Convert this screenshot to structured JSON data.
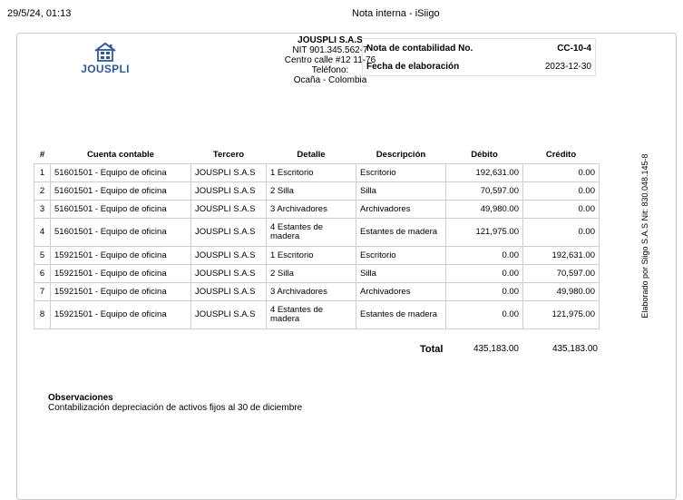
{
  "print_header": {
    "datetime": "29/5/24, 01:13",
    "title": "Nota interna - iSiigo"
  },
  "logo": {
    "icon": "house-icon",
    "text": "JOUSPLI",
    "color": "#2b5aa0"
  },
  "company": {
    "name": "JOUSPLI S.A.S",
    "nit": "NIT 901.345.562-7",
    "address": "Centro calle #12 11-76",
    "phone": "Teléfono:",
    "location": "Ocaña - Colombia"
  },
  "meta": {
    "note_label": "Nota de contabilidad No.",
    "note_value": "CC-10-4",
    "date_label": "Fecha de elaboración",
    "date_value": "2023-12-30"
  },
  "table": {
    "headers": [
      "#",
      "Cuenta contable",
      "Tercero",
      "Detalle",
      "Descripción",
      "Débito",
      "Crédito"
    ],
    "rows": [
      {
        "n": "1",
        "cuenta": "51601501 - Equipo de oficina",
        "tercero": "JOUSPLI S.A.S",
        "detalle": "1 Escritorio",
        "descripcion": "Escritorio",
        "debito": "192,631.00",
        "credito": "0.00"
      },
      {
        "n": "2",
        "cuenta": "51601501 - Equipo de oficina",
        "tercero": "JOUSPLI S.A.S",
        "detalle": "2 Silla",
        "descripcion": "Silla",
        "debito": "70,597.00",
        "credito": "0.00"
      },
      {
        "n": "3",
        "cuenta": "51601501 - Equipo de oficina",
        "tercero": "JOUSPLI S.A.S",
        "detalle": "3 Archivadores",
        "descripcion": "Archivadores",
        "debito": "49,980.00",
        "credito": "0.00"
      },
      {
        "n": "4",
        "cuenta": "51601501 - Equipo de oficina",
        "tercero": "JOUSPLI S.A.S",
        "detalle": "4 Estantes de madera",
        "descripcion": "Estantes de madera",
        "debito": "121,975.00",
        "credito": "0.00"
      },
      {
        "n": "5",
        "cuenta": "15921501 - Equipo de oficina",
        "tercero": "JOUSPLI S.A.S",
        "detalle": "1 Escritorio",
        "descripcion": "Escritorio",
        "debito": "0.00",
        "credito": "192,631.00"
      },
      {
        "n": "6",
        "cuenta": "15921501 - Equipo de oficina",
        "tercero": "JOUSPLI S.A.S",
        "detalle": "2 Silla",
        "descripcion": "Silla",
        "debito": "0.00",
        "credito": "70,597.00"
      },
      {
        "n": "7",
        "cuenta": "15921501 - Equipo de oficina",
        "tercero": "JOUSPLI S.A.S",
        "detalle": "3 Archivadores",
        "descripcion": "Archivadores",
        "debito": "0.00",
        "credito": "49,980.00"
      },
      {
        "n": "8",
        "cuenta": "15921501 - Equipo de oficina",
        "tercero": "JOUSPLI S.A.S",
        "detalle": "4 Estantes de madera",
        "descripcion": "Estantes de madera",
        "debito": "0.00",
        "credito": "121,975.00"
      }
    ]
  },
  "totals": {
    "label": "Total",
    "debito": "435,183.00",
    "credito": "435,183.00"
  },
  "observaciones": {
    "title": "Observaciones",
    "text": "Contabilización depreciación de activos fijos al 30 de diciembre"
  },
  "side_note": "Elaborado por Siigo S.A.S Nit: 830.048.145-8"
}
